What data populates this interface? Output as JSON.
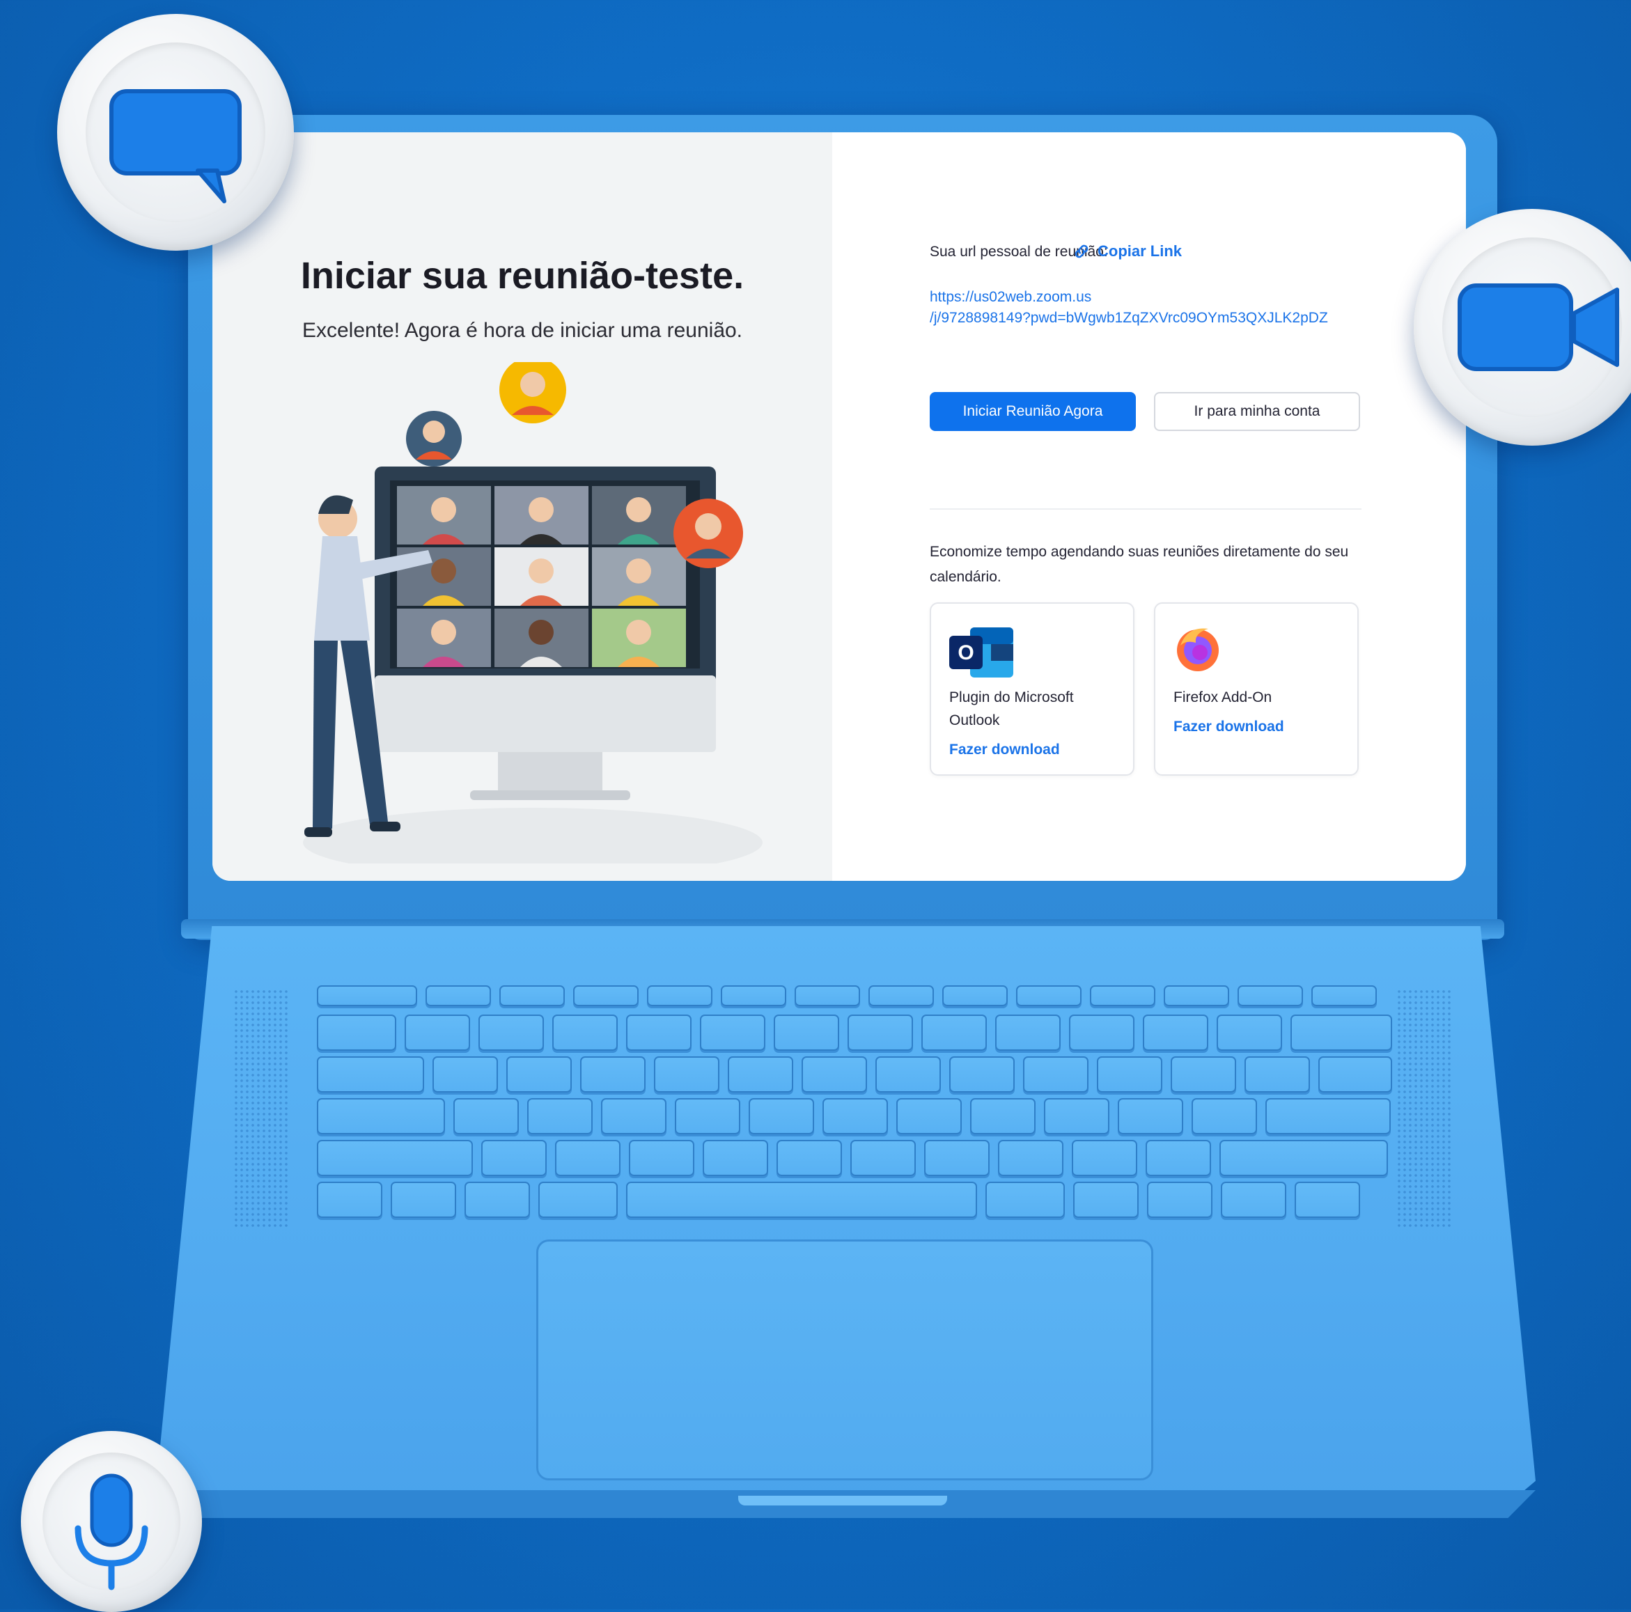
{
  "meeting_page": {
    "title": "Iniciar sua reunião-teste.",
    "subtitle": "Excelente! Agora é hora de iniciar uma reunião.",
    "url_label": "Sua url pessoal de reunião:",
    "copy_link_label": "Copiar Link",
    "url_line1": "https://us02web.zoom.us",
    "url_line2": "/j/9728898149?pwd=bWgwb1ZqZXVrc09OYm53QXJLK2pDZ",
    "start_button": "Iniciar Reunião Agora",
    "account_button": "Ir para minha conta",
    "calendar_text": "Economize tempo agendando suas reuniões diretamente do seu calendário.",
    "plugins": [
      {
        "name": "Plugin do Microsoft Outlook",
        "download": "Fazer download",
        "icon": "outlook-icon"
      },
      {
        "name": "Firefox Add-On",
        "download": "Fazer download",
        "icon": "firefox-icon"
      }
    ]
  },
  "floating_buttons": [
    {
      "icon": "chat-icon"
    },
    {
      "icon": "video-camera-icon"
    },
    {
      "icon": "microphone-icon"
    }
  ],
  "colors": {
    "background": "#0f6cc4",
    "laptop": "#55aef2",
    "primary_button": "#0e72ed",
    "link": "#1a73e8"
  }
}
